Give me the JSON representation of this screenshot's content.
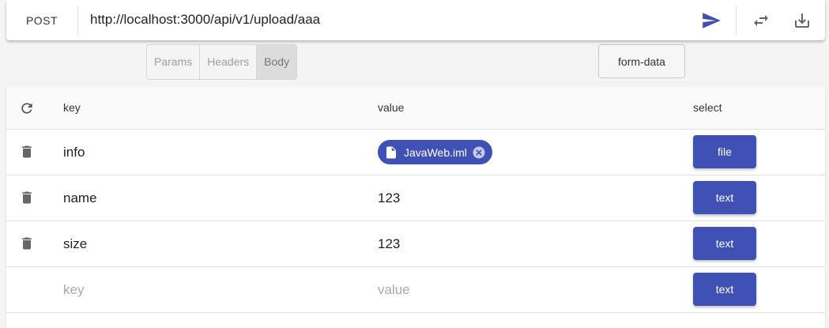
{
  "request": {
    "method": "POST",
    "url": "http://localhost:3000/api/v1/upload/aaa"
  },
  "toolbar": {
    "send_icon": "send-icon",
    "swap_icon": "swap-icon",
    "download_icon": "download-icon"
  },
  "tabs": [
    {
      "label": "Params",
      "active": false
    },
    {
      "label": "Headers",
      "active": false
    },
    {
      "label": "Body",
      "active": true
    }
  ],
  "body_type": "form-data",
  "table": {
    "columns": {
      "key": "key",
      "value": "value",
      "select": "select"
    },
    "rows": [
      {
        "key": "info",
        "value": "JavaWeb.iml",
        "value_kind": "file-chip",
        "type": "file"
      },
      {
        "key": "name",
        "value": "123",
        "value_kind": "text",
        "type": "text"
      },
      {
        "key": "size",
        "value": "123",
        "value_kind": "text",
        "type": "text"
      }
    ],
    "new_row": {
      "key_placeholder": "key",
      "value_placeholder": "value",
      "type": "text"
    }
  },
  "colors": {
    "accent": "#3f51b5"
  }
}
